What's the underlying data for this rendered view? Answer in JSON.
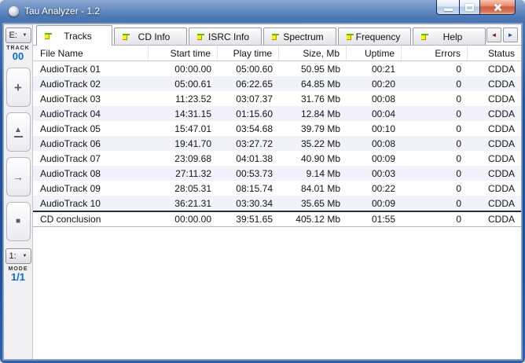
{
  "window": {
    "title": "Tau Analyzer - 1.2"
  },
  "drive_selector": {
    "value": "E:"
  },
  "track_indicator": {
    "label": "TRACK",
    "value": "00"
  },
  "mode_selector": {
    "value": "1:"
  },
  "mode_indicator": {
    "label": "MODE",
    "value": "1/1"
  },
  "icons": {
    "dropdown_arrow": "▼",
    "plus": "+",
    "eject_triangle": "▲",
    "arrow_right": "→",
    "stop": "■",
    "tab_scroll_left": "◄",
    "tab_scroll_right": "►"
  },
  "tabs": [
    {
      "label": "Tracks",
      "active": true
    },
    {
      "label": "CD Info",
      "active": false
    },
    {
      "label": "ISRC Info",
      "active": false
    },
    {
      "label": "Spectrum",
      "active": false
    },
    {
      "label": "Frequency",
      "active": false
    },
    {
      "label": "Help",
      "active": false
    }
  ],
  "table": {
    "columns": [
      "File Name",
      "Start time",
      "Play time",
      "Size, Mb",
      "Uptime",
      "Errors",
      "Status"
    ],
    "rows": [
      [
        "AudioTrack 01",
        "00:00.00",
        "05:00.60",
        "50.95 Mb",
        "00:21",
        "0",
        "CDDA"
      ],
      [
        "AudioTrack 02",
        "05:00.61",
        "06:22.65",
        "64.85 Mb",
        "00:20",
        "0",
        "CDDA"
      ],
      [
        "AudioTrack 03",
        "11:23.52",
        "03:07.37",
        "31.76 Mb",
        "00:08",
        "0",
        "CDDA"
      ],
      [
        "AudioTrack 04",
        "14:31.15",
        "01:15.60",
        "12.84 Mb",
        "00:04",
        "0",
        "CDDA"
      ],
      [
        "AudioTrack 05",
        "15:47.01",
        "03:54.68",
        "39.79 Mb",
        "00:10",
        "0",
        "CDDA"
      ],
      [
        "AudioTrack 06",
        "19:41.70",
        "03:27.72",
        "35.22 Mb",
        "00:08",
        "0",
        "CDDA"
      ],
      [
        "AudioTrack 07",
        "23:09.68",
        "04:01.38",
        "40.90 Mb",
        "00:09",
        "0",
        "CDDA"
      ],
      [
        "AudioTrack 08",
        "27:11.32",
        "00:53.73",
        "9.14 Mb",
        "00:03",
        "0",
        "CDDA"
      ],
      [
        "AudioTrack 09",
        "28:05.31",
        "08:15.74",
        "84.01 Mb",
        "00:22",
        "0",
        "CDDA"
      ],
      [
        "AudioTrack 10",
        "36:21.31",
        "03:30.34",
        "35.65 Mb",
        "00:09",
        "0",
        "CDDA"
      ]
    ],
    "summary_row": [
      "CD conclusion",
      "00:00.00",
      "39:51.65",
      "405.12 Mb",
      "01:55",
      "0",
      "CDDA"
    ]
  },
  "colors": {
    "window_border_blue": "#1d4f9a",
    "value_blue": "#0a6cd6",
    "row_alt": "#f1f2fa",
    "close_button_red": "#ce5c3b",
    "tab_flag_green": "#55c400",
    "tab_flag_yellow": "#ffee00"
  }
}
